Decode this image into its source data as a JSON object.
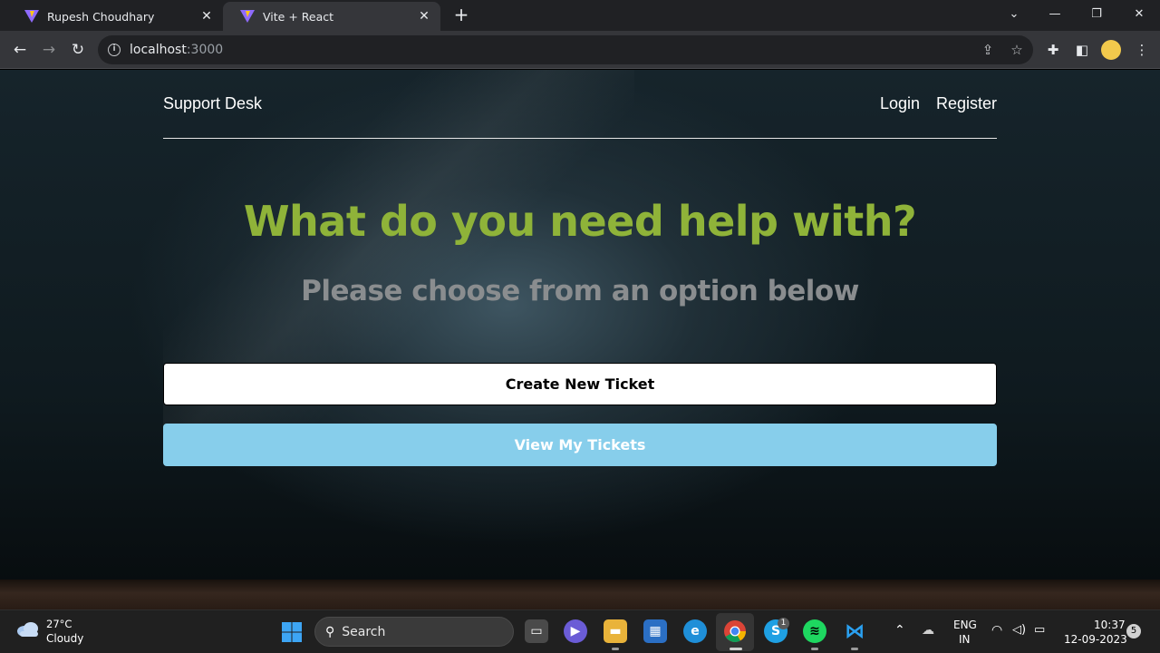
{
  "browser": {
    "tabs": [
      {
        "title": "Rupesh Choudhary",
        "active": false
      },
      {
        "title": "Vite + React",
        "active": true
      }
    ],
    "url_host": "localhost",
    "url_port": ":3000"
  },
  "page": {
    "brand": "Support Desk",
    "nav": {
      "login": "Login",
      "register": "Register"
    },
    "headline": "What do you need help with?",
    "subheadline": "Please choose from an option below",
    "buttons": {
      "create": "Create New Ticket",
      "view": "View My Tickets"
    }
  },
  "taskbar": {
    "weather": {
      "temp": "27°C",
      "desc": "Cloudy"
    },
    "search_label": "Search",
    "skype_badge": "1",
    "lang_top": "ENG",
    "lang_bottom": "IN",
    "time": "10:37",
    "date": "12-09-2023",
    "notifications": "5"
  },
  "colors": {
    "headline": "#8fb339",
    "subheadline": "#8a8d8f",
    "view_button": "#87ceeb",
    "create_button": "#ffffff"
  }
}
